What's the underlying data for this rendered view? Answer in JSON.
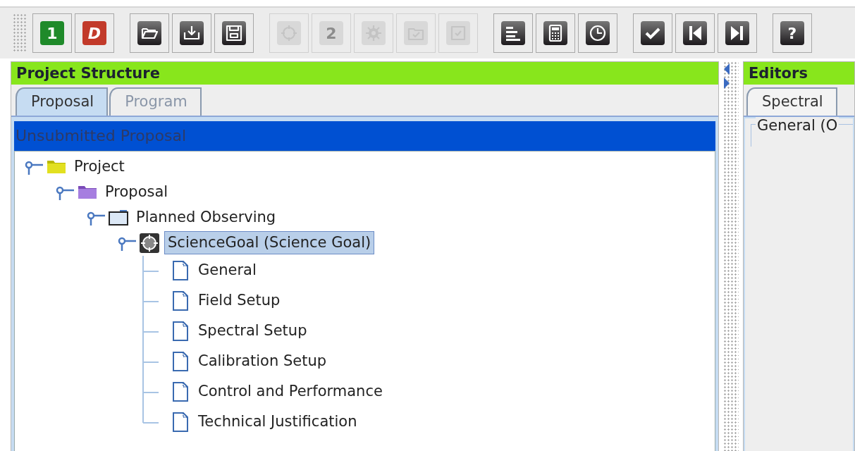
{
  "toolbar": {
    "groups": [
      [
        {
          "kind": "number",
          "glyph": "1",
          "disabled": false,
          "color": "#1f8a2a"
        },
        {
          "kind": "letter",
          "glyph": "D",
          "disabled": false,
          "color": "#c23a2a"
        }
      ],
      [
        {
          "kind": "open",
          "disabled": false
        },
        {
          "kind": "import",
          "disabled": false
        },
        {
          "kind": "save",
          "disabled": false
        }
      ],
      [
        {
          "kind": "target",
          "disabled": true
        },
        {
          "kind": "gear-number",
          "glyph": "2",
          "disabled": true
        },
        {
          "kind": "gear",
          "disabled": true
        },
        {
          "kind": "folder-check",
          "disabled": true
        },
        {
          "kind": "checkbox",
          "disabled": true
        }
      ],
      [
        {
          "kind": "bars",
          "disabled": false
        },
        {
          "kind": "calculator",
          "disabled": false
        },
        {
          "kind": "clock",
          "disabled": false
        }
      ],
      [
        {
          "kind": "check",
          "disabled": false
        },
        {
          "kind": "skip-back",
          "disabled": false
        },
        {
          "kind": "skip-forward",
          "disabled": false
        }
      ],
      [
        {
          "kind": "help",
          "glyph": "?",
          "disabled": false
        }
      ]
    ]
  },
  "project_structure": {
    "title": "Project Structure",
    "tabs": [
      {
        "label": "Proposal",
        "selected": true
      },
      {
        "label": "Program",
        "selected": false
      }
    ],
    "banner": "Unsubmitted Proposal",
    "tree": [
      {
        "label": "Project",
        "kind": "project",
        "expanded": true,
        "selected": false,
        "children": [
          {
            "label": "Proposal",
            "kind": "proposal",
            "expanded": true,
            "selected": false,
            "children": [
              {
                "label": "Planned Observing",
                "kind": "folder",
                "expanded": true,
                "selected": false,
                "children": [
                  {
                    "label": "ScienceGoal (Science Goal)",
                    "kind": "goal",
                    "expanded": true,
                    "selected": true,
                    "children": [
                      {
                        "label": "General",
                        "kind": "page",
                        "selected": false
                      },
                      {
                        "label": "Field Setup",
                        "kind": "page",
                        "selected": false
                      },
                      {
                        "label": "Spectral Setup",
                        "kind": "page",
                        "selected": false
                      },
                      {
                        "label": "Calibration Setup",
                        "kind": "page",
                        "selected": false
                      },
                      {
                        "label": "Control and Performance",
                        "kind": "page",
                        "selected": false
                      },
                      {
                        "label": "Technical Justification",
                        "kind": "page",
                        "selected": false
                      }
                    ]
                  }
                ]
              }
            ]
          }
        ]
      }
    ]
  },
  "editors": {
    "title": "Editors",
    "tabs": [
      {
        "label": "Spectral",
        "selected": true
      }
    ],
    "group_title": "General (O"
  }
}
